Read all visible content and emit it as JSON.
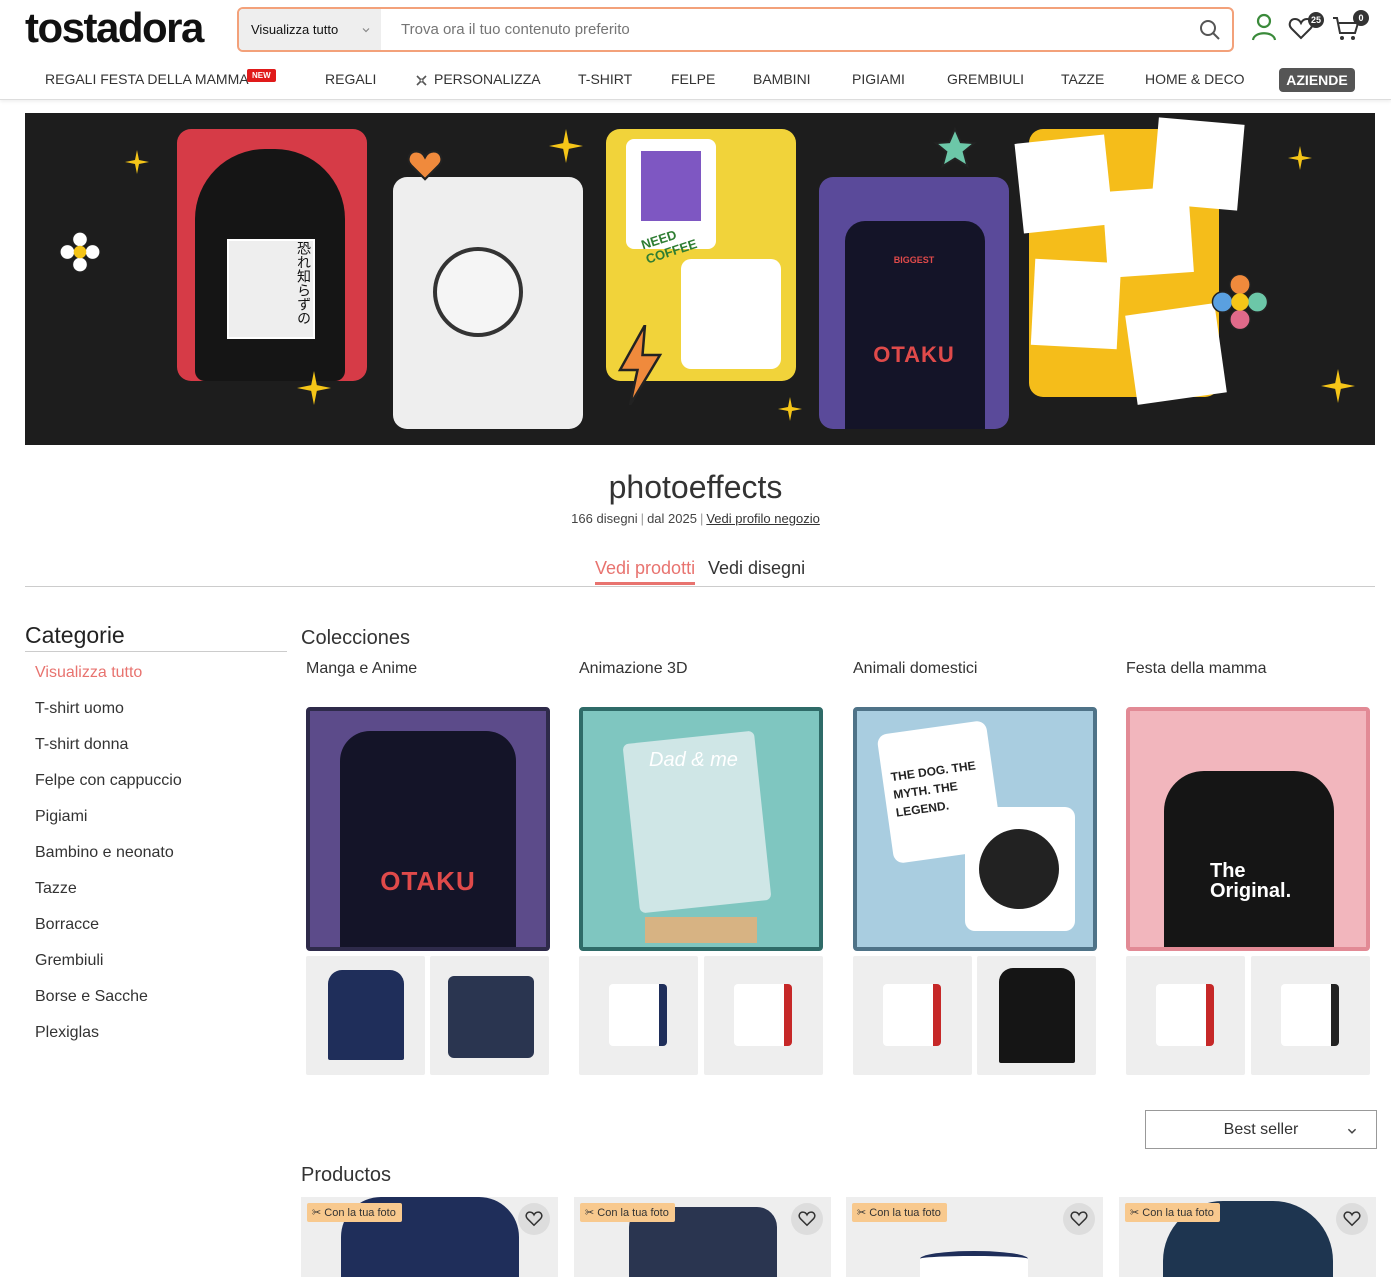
{
  "header": {
    "logo": "tostadora",
    "search_category": "Visualizza tutto",
    "search_placeholder": "Trova ora il tuo contenuto preferito",
    "wishlist_count": "25",
    "cart_count": "0"
  },
  "nav": {
    "items": [
      "REGALI FESTA DELLA MAMMA",
      "REGALI",
      "PERSONALIZZA",
      "T-SHIRT",
      "FELPE",
      "BAMBINI",
      "PIGIAMI",
      "GREMBIULI",
      "TAZZE",
      "HOME & DECO"
    ],
    "new_badge": "NEW",
    "business": "AZIENDE"
  },
  "banner": {
    "texts": [
      "恐れ知らずの",
      "NEED COFFEE",
      "BIGGEST",
      "OTAKU"
    ]
  },
  "shop": {
    "name": "photoeffects",
    "designs": "166 disegni",
    "since": "dal 2025",
    "profile_link": "Vedi profilo negozio"
  },
  "tabs": {
    "products": "Vedi prodotti",
    "designs": "Vedi disegni"
  },
  "sidebar": {
    "title": "Categorie",
    "items": [
      "Visualizza tutto",
      "T-shirt uomo",
      "T-shirt donna",
      "Felpe con cappuccio",
      "Pigiami",
      "Bambino e neonato",
      "Tazze",
      "Borracce",
      "Grembiuli",
      "Borse e Sacche",
      "Plexiglas"
    ]
  },
  "collections": {
    "title": "Colecciones",
    "items": [
      {
        "name": "Manga e Anime",
        "border": "#2e2a4a",
        "bg": "#5c4b8a",
        "text": "OTAKU"
      },
      {
        "name": "Animazione 3D",
        "border": "#2f6b68",
        "bg": "#7fc6c0",
        "text": "Dad & me"
      },
      {
        "name": "Animali domestici",
        "border": "#4f7388",
        "bg": "#a9cde0",
        "text": "THE DOG. THE MYTH. THE LEGEND."
      },
      {
        "name": "Festa della mamma",
        "border": "#e28a95",
        "bg": "#f2b6bd",
        "text": "The Original."
      }
    ]
  },
  "sort": {
    "selected": "Best seller"
  },
  "products": {
    "title": "Productos",
    "tag": "Con la tua foto"
  },
  "colors": {
    "accent": "#e8736f",
    "search_border": "#f3a17a",
    "new": "#e01a1a",
    "tag": "#f8c98e"
  }
}
